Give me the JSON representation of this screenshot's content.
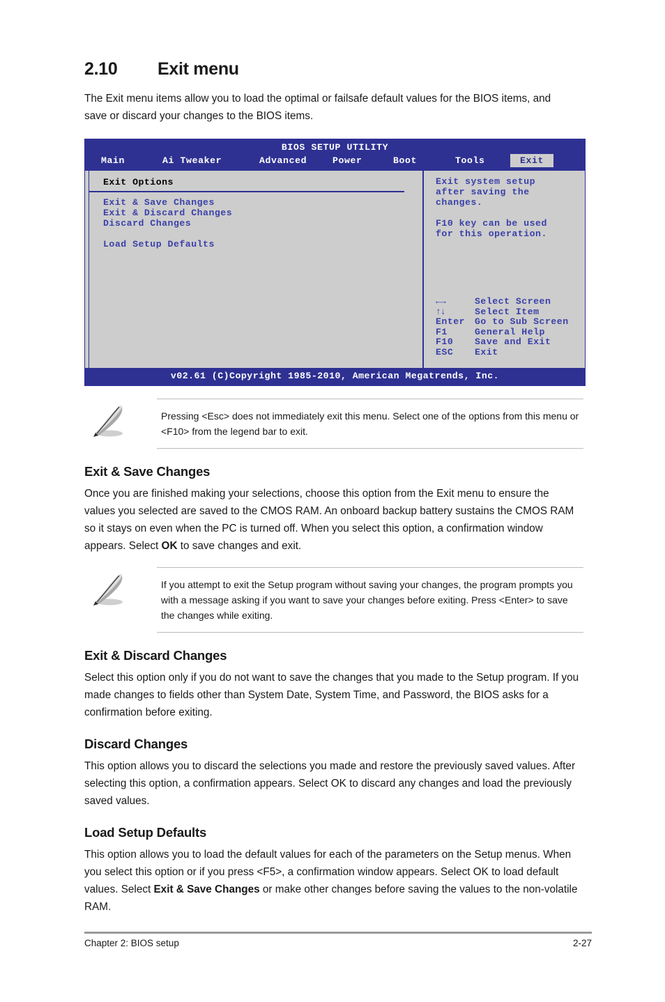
{
  "section": {
    "number": "2.10",
    "title": "Exit menu",
    "intro": "The Exit menu items allow you to load the optimal or failsafe default values for the BIOS items, and save or discard your changes to the BIOS items."
  },
  "bios": {
    "title": "BIOS SETUP UTILITY",
    "tabs": [
      {
        "label": "Main",
        "active": false
      },
      {
        "label": "Ai Tweaker",
        "active": false
      },
      {
        "label": "Advanced",
        "active": false
      },
      {
        "label": "Power",
        "active": false
      },
      {
        "label": "Boot",
        "active": false
      },
      {
        "label": "Tools",
        "active": false
      },
      {
        "label": "Exit",
        "active": true
      }
    ],
    "panel_heading": "Exit Options",
    "options": [
      "Exit & Save Changes",
      "Exit & Discard Changes",
      "Discard Changes",
      "Load Setup Defaults"
    ],
    "help": {
      "paragraph1_line1": "Exit system setup",
      "paragraph1_line2": "after saving the",
      "paragraph1_line3": "changes.",
      "paragraph2_line1": "F10 key can be used",
      "paragraph2_line2": "for this operation."
    },
    "legend": [
      {
        "key": "←→",
        "action": "Select Screen"
      },
      {
        "key": "↑↓",
        "action": "Select Item"
      },
      {
        "key": "Enter",
        "action": "Go to Sub Screen"
      },
      {
        "key": "F1",
        "action": "General Help"
      },
      {
        "key": "F10",
        "action": "Save and Exit"
      },
      {
        "key": "ESC",
        "action": "Exit"
      }
    ],
    "copyright": "v02.61 (C)Copyright 1985-2010, American Megatrends, Inc.",
    "colors": {
      "chrome_blue": "#2e3192",
      "panel_gray": "#cdcdcd",
      "text_blue": "#3b41a8"
    }
  },
  "notes": [
    {
      "icon": "note-pencil-icon",
      "text": "Pressing <Esc> does not immediately exit this menu. Select one of the options from this menu or <F10> from the legend bar to exit."
    },
    {
      "icon": "note-pencil-icon",
      "text": "If you attempt to exit the Setup program without saving your changes, the program prompts you with a message asking if you want to save your changes before exiting. Press <Enter> to save the changes while exiting."
    }
  ],
  "subsections": [
    {
      "heading": "Exit & Save Changes",
      "body_pre": "Once you are finished making your selections, choose this option from the Exit menu to ensure the values you selected are saved to the CMOS RAM. An onboard backup battery sustains the CMOS RAM so it stays on even when the PC is turned off. When you select this option, a confirmation window appears. Select ",
      "body_bold": "OK",
      "body_post": " to save changes and exit."
    },
    {
      "heading": "Exit & Discard Changes",
      "body_pre": "Select this option only if you do not want to save the changes that you  made to the Setup program. If you made changes to fields other than System Date, System Time, and Password, the BIOS asks for a confirmation before exiting.",
      "body_bold": "",
      "body_post": ""
    },
    {
      "heading": "Discard Changes",
      "body_pre": "This option allows you to discard the selections you made and restore the previously saved values. After selecting this option, a confirmation appears. Select OK to discard any changes and load the previously saved values.",
      "body_bold": "",
      "body_post": ""
    },
    {
      "heading": "Load Setup Defaults",
      "body_pre": "This option allows you to load the default values for each of the parameters on the Setup menus. When you select this option or if you press <F5>, a confirmation window appears. Select OK to load default values. Select ",
      "body_bold": "Exit & Save Changes",
      "body_post": " or make other changes before saving the values to the non-volatile RAM."
    }
  ],
  "footer": {
    "chapter": "Chapter 2: BIOS setup",
    "page": "2-27"
  }
}
